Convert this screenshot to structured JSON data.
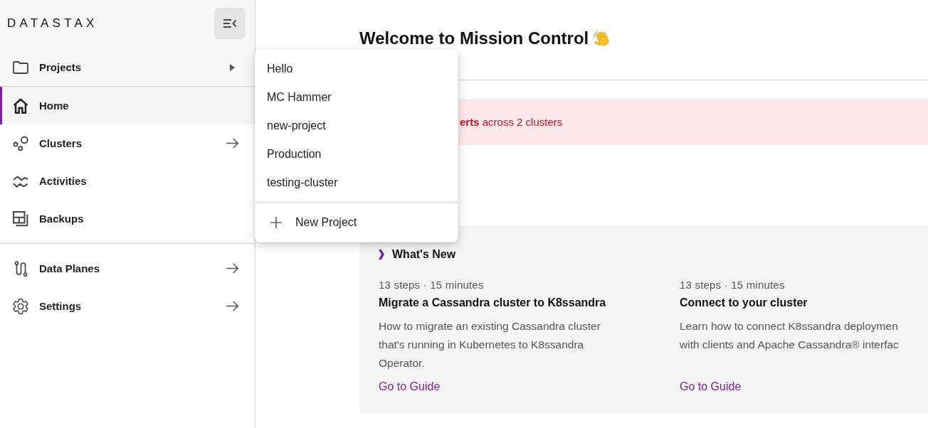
{
  "sidebar": {
    "logo": "DATASTAX",
    "projects": {
      "label": "Projects"
    },
    "sections": [
      {
        "items": [
          {
            "label": "Home",
            "kind": "page",
            "selected": true
          },
          {
            "label": "Clusters",
            "kind": "link",
            "selected": false
          },
          {
            "label": "Activities",
            "kind": "page",
            "selected": false
          },
          {
            "label": "Backups",
            "kind": "page",
            "selected": false
          }
        ]
      },
      {
        "items": [
          {
            "label": "Data Planes",
            "kind": "link",
            "selected": false
          },
          {
            "label": "Settings",
            "kind": "link",
            "selected": false
          }
        ]
      }
    ]
  },
  "projects_menu": {
    "items": [
      "Hello",
      "MC Hammer",
      "new-project",
      "Production",
      "testing-cluster"
    ],
    "action": "New Project"
  },
  "main": {
    "title": "Welcome to Mission Control",
    "alert": "**erts** across 2 clusters",
    "whats_new": {
      "title": "What's New",
      "guides": [
        {
          "meta": "13 steps · 15 minutes",
          "title": "Migrate a Cassandra cluster to K8ssandra",
          "description_lines": [
            "How to migrate an existing Cassandra cluster",
            "that's running in Kubernetes to K8ssandra",
            "Operator."
          ],
          "link": "Go to Guide"
        },
        {
          "meta": "13 steps · 15 minutes",
          "title": "Connect to your cluster",
          "description_lines": [
            "Learn how to connect K8ssandra deploymen",
            "with clients and Apache Cassandra® interfac"
          ],
          "link": "Go to Guide"
        }
      ]
    }
  }
}
